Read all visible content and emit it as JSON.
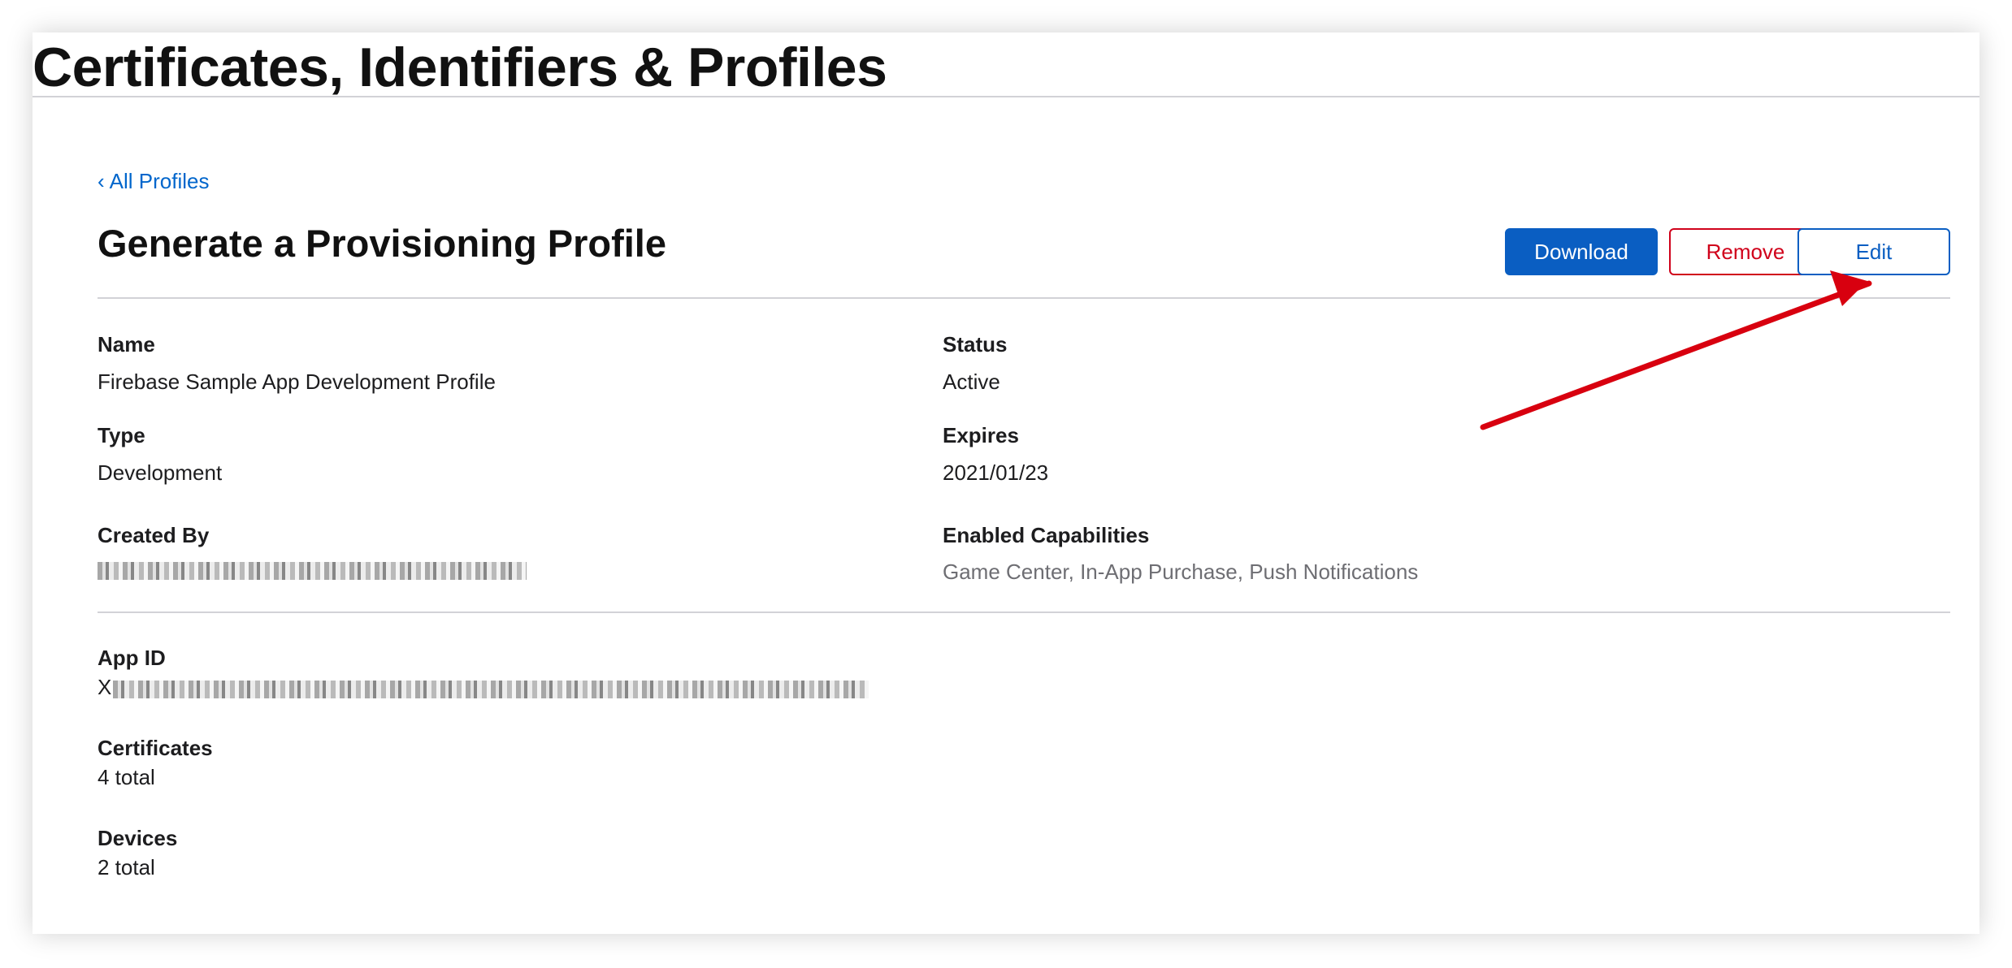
{
  "header": {
    "title": "Certificates, Identifiers & Profiles"
  },
  "nav": {
    "back_label": "All Profiles",
    "back_chevron": "‹"
  },
  "profile": {
    "title": "Generate a Provisioning Profile",
    "actions": {
      "download": "Download",
      "remove": "Remove",
      "edit": "Edit"
    },
    "fields": {
      "name_label": "Name",
      "name_value": "Firebase Sample App Development Profile",
      "status_label": "Status",
      "status_value": "Active",
      "type_label": "Type",
      "type_value": "Development",
      "expires_label": "Expires",
      "expires_value": "2021/01/23",
      "created_by_label": "Created By",
      "capabilities_label": "Enabled Capabilities",
      "capabilities_value": "Game Center, In-App Purchase, Push Notifications",
      "app_id_label": "App ID",
      "app_id_prefix": "X",
      "certificates_label": "Certificates",
      "certificates_value": "4 total",
      "devices_label": "Devices",
      "devices_value": "2 total"
    }
  },
  "colors": {
    "primary_blue": "#0a5ec2",
    "link_blue": "#0066cc",
    "remove_red": "#d0021b",
    "annotation_red": "#d8000f"
  }
}
